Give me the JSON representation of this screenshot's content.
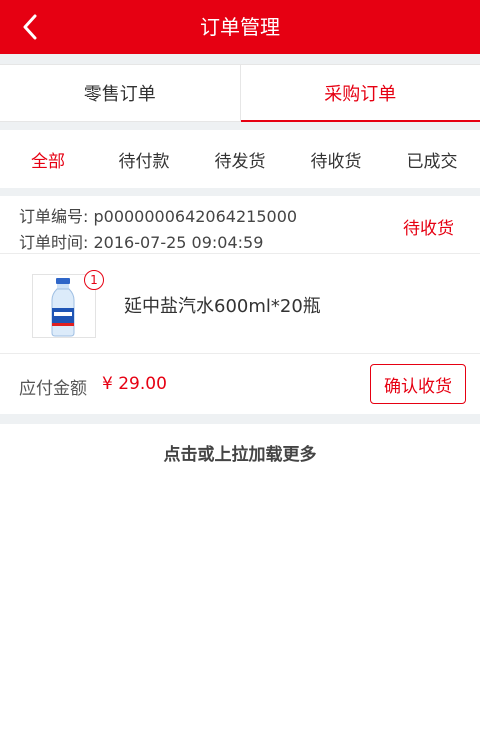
{
  "header": {
    "title": "订单管理",
    "back_icon": "chevron-left-icon",
    "color": "#e60012"
  },
  "segment_tabs": [
    {
      "label": "零售订单",
      "active": false
    },
    {
      "label": "采购订单",
      "active": true
    }
  ],
  "status_tabs": [
    {
      "label": "全部",
      "active": true
    },
    {
      "label": "待付款",
      "active": false
    },
    {
      "label": "待发货",
      "active": false
    },
    {
      "label": "待收货",
      "active": false
    },
    {
      "label": "已成交",
      "active": false
    }
  ],
  "order": {
    "number_text": "订单编号: p0000000642064215000",
    "time_text": "订单时间: 2016-07-25 09:04:59",
    "status": "待收货",
    "product": {
      "name": "延中盐汽水600ml*20瓶",
      "quantity": "1"
    },
    "amount_label": "应付金额",
    "amount": "¥ 29.00",
    "action_label": "确认收货"
  },
  "load_more": "点击或上拉加载更多",
  "colors": {
    "accent": "#e60012",
    "divider": "#eef1f3"
  }
}
